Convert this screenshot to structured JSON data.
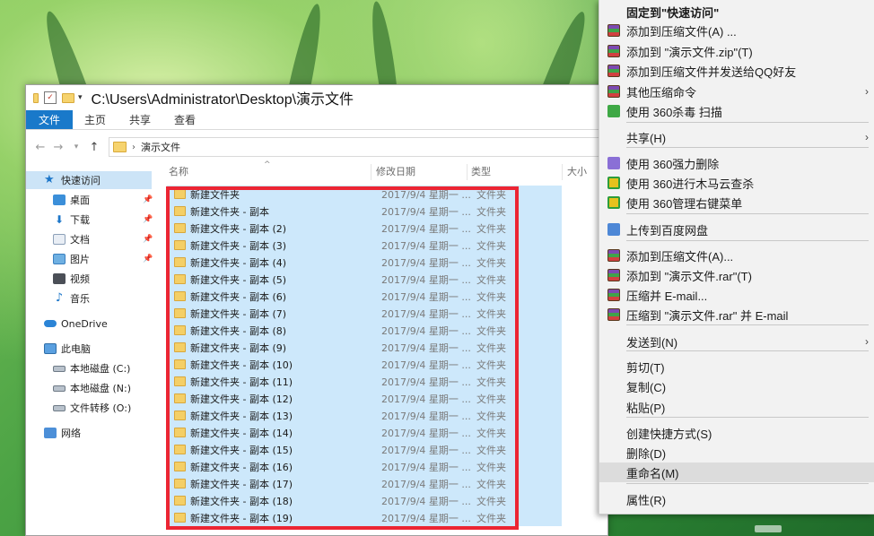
{
  "explorer": {
    "title_path": "C:\\Users\\Administrator\\Desktop\\演示文件",
    "ribbon_tabs": [
      "文件",
      "主页",
      "共享",
      "查看"
    ],
    "address_crumb": "演示文件",
    "nav": [
      {
        "label": "快速访问",
        "icon": "star-icon"
      },
      {
        "label": "桌面",
        "icon": "desktop-icon",
        "pinned": true
      },
      {
        "label": "下载",
        "icon": "download-icon",
        "pinned": true
      },
      {
        "label": "文档",
        "icon": "document-icon",
        "pinned": true
      },
      {
        "label": "图片",
        "icon": "picture-icon",
        "pinned": true
      },
      {
        "label": "视频",
        "icon": "video-icon"
      },
      {
        "label": "音乐",
        "icon": "music-icon"
      },
      {
        "label": "OneDrive",
        "icon": "onedrive-icon"
      },
      {
        "label": "此电脑",
        "icon": "computer-icon"
      },
      {
        "label": "本地磁盘 (C:)",
        "icon": "drive-icon"
      },
      {
        "label": "本地磁盘 (N:)",
        "icon": "drive-icon"
      },
      {
        "label": "文件转移 (O:)",
        "icon": "drive-icon"
      },
      {
        "label": "网络",
        "icon": "network-icon"
      }
    ],
    "columns": {
      "name": "名称",
      "date": "修改日期",
      "type": "类型",
      "size": "大小"
    },
    "files": [
      {
        "name": "新建文件夹",
        "date": "2017/9/4 星期一 ...",
        "type": "文件夹"
      },
      {
        "name": "新建文件夹 - 副本",
        "date": "2017/9/4 星期一 ...",
        "type": "文件夹"
      },
      {
        "name": "新建文件夹 - 副本 (2)",
        "date": "2017/9/4 星期一 ...",
        "type": "文件夹"
      },
      {
        "name": "新建文件夹 - 副本 (3)",
        "date": "2017/9/4 星期一 ...",
        "type": "文件夹"
      },
      {
        "name": "新建文件夹 - 副本 (4)",
        "date": "2017/9/4 星期一 ...",
        "type": "文件夹"
      },
      {
        "name": "新建文件夹 - 副本 (5)",
        "date": "2017/9/4 星期一 ...",
        "type": "文件夹"
      },
      {
        "name": "新建文件夹 - 副本 (6)",
        "date": "2017/9/4 星期一 ...",
        "type": "文件夹"
      },
      {
        "name": "新建文件夹 - 副本 (7)",
        "date": "2017/9/4 星期一 ...",
        "type": "文件夹"
      },
      {
        "name": "新建文件夹 - 副本 (8)",
        "date": "2017/9/4 星期一 ...",
        "type": "文件夹"
      },
      {
        "name": "新建文件夹 - 副本 (9)",
        "date": "2017/9/4 星期一 ...",
        "type": "文件夹"
      },
      {
        "name": "新建文件夹 - 副本 (10)",
        "date": "2017/9/4 星期一 ...",
        "type": "文件夹"
      },
      {
        "name": "新建文件夹 - 副本 (11)",
        "date": "2017/9/4 星期一 ...",
        "type": "文件夹"
      },
      {
        "name": "新建文件夹 - 副本 (12)",
        "date": "2017/9/4 星期一 ...",
        "type": "文件夹"
      },
      {
        "name": "新建文件夹 - 副本 (13)",
        "date": "2017/9/4 星期一 ...",
        "type": "文件夹"
      },
      {
        "name": "新建文件夹 - 副本 (14)",
        "date": "2017/9/4 星期一 ...",
        "type": "文件夹"
      },
      {
        "name": "新建文件夹 - 副本 (15)",
        "date": "2017/9/4 星期一 ...",
        "type": "文件夹"
      },
      {
        "name": "新建文件夹 - 副本 (16)",
        "date": "2017/9/4 星期一 ...",
        "type": "文件夹"
      },
      {
        "name": "新建文件夹 - 副本 (17)",
        "date": "2017/9/4 星期一 ...",
        "type": "文件夹"
      },
      {
        "name": "新建文件夹 - 副本 (18)",
        "date": "2017/9/4 星期一 ...",
        "type": "文件夹"
      },
      {
        "name": "新建文件夹 - 副本 (19)",
        "date": "2017/9/4 星期一 ...",
        "type": "文件夹"
      }
    ]
  },
  "context_menu": {
    "items": [
      {
        "label": "固定到\"快速访问\"",
        "bold": true
      },
      {
        "label": "添加到压缩文件(A) ...",
        "icon": "winrar-icon"
      },
      {
        "label": "添加到 \"演示文件.zip\"(T)",
        "icon": "winrar-icon"
      },
      {
        "label": "添加到压缩文件并发送给QQ好友",
        "icon": "winrar-icon"
      },
      {
        "label": "其他压缩命令",
        "icon": "winrar-icon",
        "submenu": true
      },
      {
        "label": "使用 360杀毒 扫描",
        "icon": "360-antivirus-icon"
      },
      {
        "label": "共享(H)",
        "submenu": true
      },
      {
        "label": "使用 360强力删除",
        "icon": "360-delete-icon"
      },
      {
        "label": "使用 360进行木马云查杀",
        "icon": "360-scan-icon"
      },
      {
        "label": "使用 360管理右键菜单",
        "icon": "360-menu-icon"
      },
      {
        "label": "上传到百度网盘",
        "icon": "baidu-netdisk-icon"
      },
      {
        "label": "添加到压缩文件(A)...",
        "icon": "winrar-icon"
      },
      {
        "label": "添加到 \"演示文件.rar\"(T)",
        "icon": "winrar-icon"
      },
      {
        "label": "压缩并 E-mail...",
        "icon": "winrar-icon"
      },
      {
        "label": "压缩到 \"演示文件.rar\" 并 E-mail",
        "icon": "winrar-icon"
      },
      {
        "label": "发送到(N)",
        "submenu": true
      },
      {
        "label": "剪切(T)"
      },
      {
        "label": "复制(C)"
      },
      {
        "label": "粘贴(P)"
      },
      {
        "label": "创建快捷方式(S)"
      },
      {
        "label": "删除(D)"
      },
      {
        "label": "重命名(M)",
        "highlighted": true
      },
      {
        "label": "属性(R)"
      }
    ],
    "submenu_arrow": "›"
  }
}
